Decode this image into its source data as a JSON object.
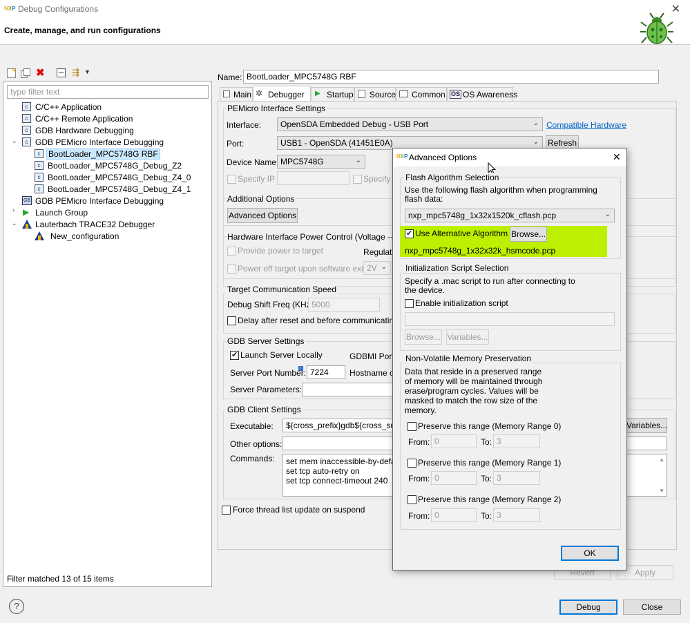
{
  "window": {
    "title": "Debug Configurations",
    "subtitle": "Create, manage, and run configurations",
    "close_glyph": "✕",
    "bug_icon": "bug-icon"
  },
  "left": {
    "filter_placeholder": "type filter text",
    "tree": [
      {
        "label": "C/C++ Application",
        "icon": "c-icon",
        "level": 1
      },
      {
        "label": "C/C++ Remote Application",
        "icon": "c-icon",
        "level": 1
      },
      {
        "label": "GDB Hardware Debugging",
        "icon": "c-icon",
        "level": 1
      },
      {
        "label": "GDB PEMicro Interface Debugging",
        "icon": "c-icon",
        "level": 1,
        "expanded": true
      },
      {
        "label": "BootLoader_MPC5748G RBF",
        "icon": "c-icon",
        "level": 2,
        "selected": true
      },
      {
        "label": "BootLoader_MPC5748G_Debug_Z2",
        "icon": "c-icon",
        "level": 2
      },
      {
        "label": "BootLoader_MPC5748G_Debug_Z4_0",
        "icon": "c-icon",
        "level": 2
      },
      {
        "label": "BootLoader_MPC5748G_Debug_Z4_1",
        "icon": "c-icon",
        "level": 2
      },
      {
        "label": "GDB PEMicro Interface Debugging",
        "icon": "gdb-icon",
        "level": 1
      },
      {
        "label": "Launch Group",
        "icon": "launch-icon",
        "level": 1,
        "collapsed": true
      },
      {
        "label": "Lauterbach TRACE32 Debugger",
        "icon": "lauterbach-icon",
        "level": 1,
        "expanded": true
      },
      {
        "label": "New_configuration",
        "icon": "lauterbach-icon",
        "level": 2
      }
    ],
    "status": "Filter matched 13 of 15 items"
  },
  "config": {
    "name_label": "Name:",
    "name_value": "BootLoader_MPC5748G RBF",
    "tabs": [
      "Main",
      "Debugger",
      "Startup",
      "Source",
      "Common",
      "OS Awareness"
    ],
    "pemicro_title": "PEMicro Interface Settings",
    "interface_label": "Interface:",
    "interface_value": "OpenSDA Embedded Debug - USB Port",
    "compatible_link": "Compatible Hardware",
    "port_label": "Port:",
    "port_value": "USB1 - OpenSDA (41451E0A)",
    "refresh": "Refresh",
    "device_label": "Device Name:",
    "device_value": "MPC5748G",
    "specify_ip": "Specify IP",
    "specify_n": "Specify N",
    "additional_title": "Additional Options",
    "advanced_btn": "Advanced Options",
    "hw_power_title": "Hardware Interface Power Control (Voltage --> P",
    "provide_power": "Provide power to target",
    "regulator": "Regulato",
    "power_off": "Power off target upon software exit",
    "voltage": "2V",
    "tcs_title": "Target Communication Speed",
    "shift_label": "Debug Shift Freq (KHz)",
    "shift_value": "5000",
    "delay_label": "Delay after reset and before communicating t",
    "gdb_server_title": "GDB Server Settings",
    "launch_local": "Launch Server Locally",
    "gdbmi_port": "GDBMI Port N",
    "server_port_label": "Server Port Number:",
    "server_port_value": "7224",
    "hostname": "Hostname or",
    "server_params": "Server Parameters:",
    "gdb_client_title": "GDB Client Settings",
    "executable_label": "Executable:",
    "executable_value": "${cross_prefix}gdb${cross_suffix",
    "variables_btn": "Variables...",
    "other_label": "Other options:",
    "commands_label": "Commands:",
    "commands": [
      "set mem inaccessible-by-defau",
      "set tcp auto-retry on",
      "set tcp connect-timeout 240"
    ],
    "force_thread": "Force thread list update on suspend",
    "revert": "Revert",
    "apply": "Apply"
  },
  "footer": {
    "help": "?",
    "debug": "Debug",
    "close": "Close"
  },
  "dialog": {
    "title": "Advanced Options",
    "close_glyph": "✕",
    "flash_title": "Flash Algorithm Selection",
    "flash_desc": "Use the following flash algorithm when programming flash data:",
    "flash_value": "nxp_mpc5748g_1x32x1520k_cflash.pcp",
    "use_alt": "Use Alternative Algorithm",
    "browse": "Browse...",
    "alt_file": "nxp_mpc5748g_1x32x32k_hsmcode.pcp",
    "highlight_color": "#bdf000",
    "init_title": "Initialization Script Selection",
    "init_desc": "Specify a .mac script to run after connecting to the device.",
    "enable_init": "Enable initialization script",
    "browse2": "Browse...",
    "variables": "Variables...",
    "nvm_title": "Non-Volatile Memory Preservation",
    "nvm_desc": "Data that reside in a preserved range of memory will be maintained through erase/program cycles. Values will be masked to match the row size of the memory.",
    "ranges": [
      {
        "label": "Preserve this range (Memory Range 0)",
        "from_label": "From:",
        "from": "0",
        "to_label": "To:",
        "to": "3"
      },
      {
        "label": "Preserve this range (Memory Range 1)",
        "from_label": "From:",
        "from": "0",
        "to_label": "To:",
        "to": "3"
      },
      {
        "label": "Preserve this range (Memory Range 2)",
        "from_label": "From:",
        "from": "0",
        "to_label": "To:",
        "to": "3"
      }
    ],
    "ok": "OK"
  }
}
